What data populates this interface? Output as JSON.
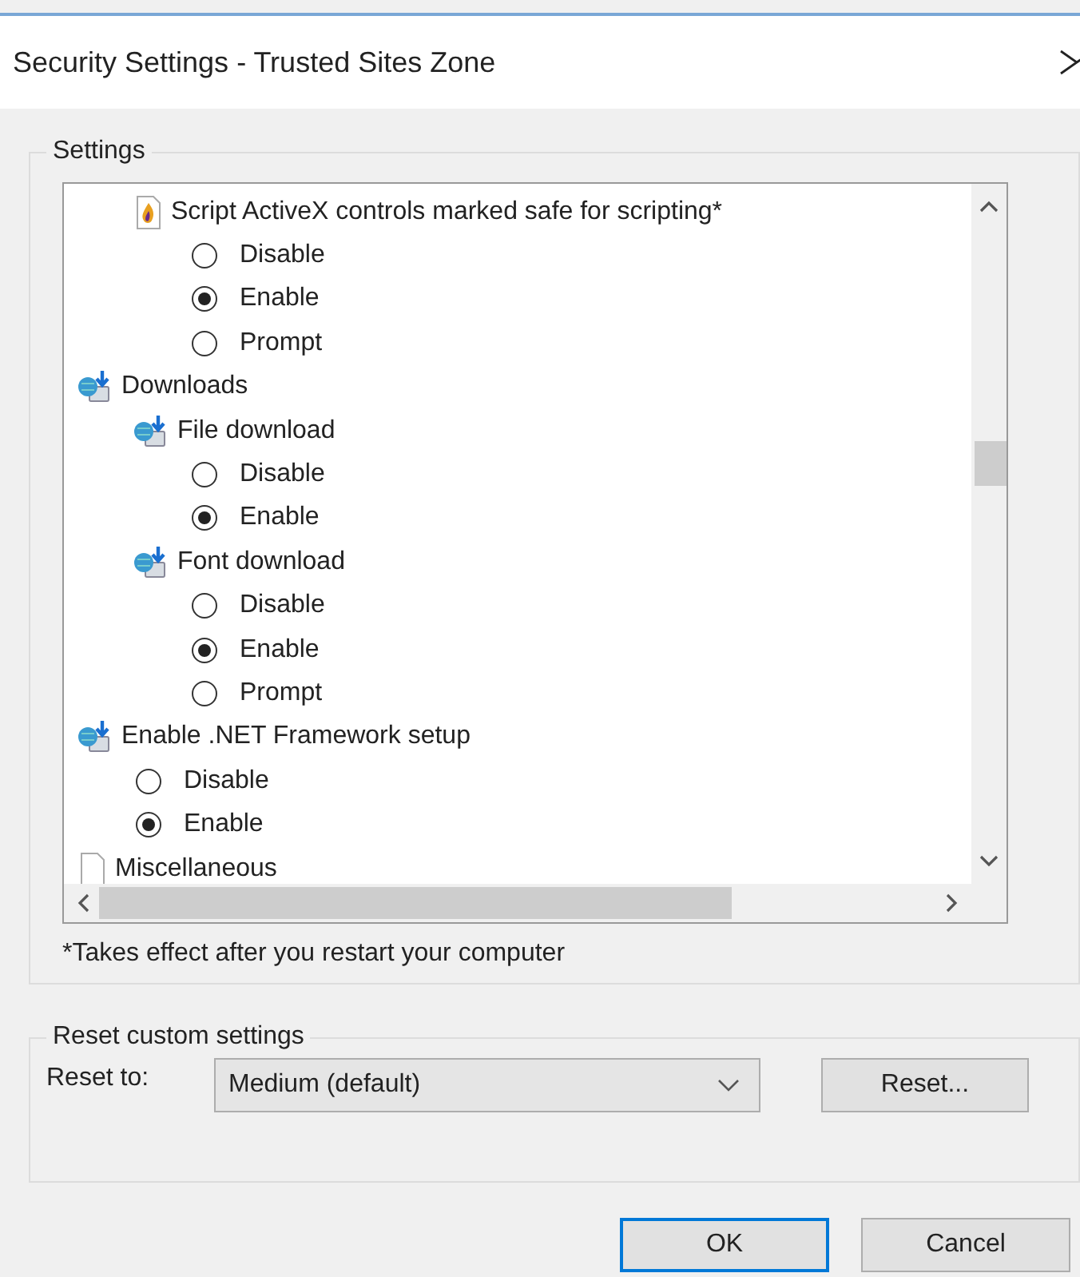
{
  "window": {
    "title": "Security Settings - Trusted Sites Zone"
  },
  "settings": {
    "legend": "Settings",
    "tree": [
      {
        "kind": "scrolled",
        "children": [
          {
            "kind": "activex",
            "label": "Script ActiveX controls marked safe for scripting*",
            "children": [
              {
                "kind": "option",
                "label": "Disable",
                "selected": false
              },
              {
                "kind": "option",
                "label": "Enable",
                "selected": true
              },
              {
                "kind": "option",
                "label": "Prompt",
                "selected": false
              }
            ]
          }
        ]
      },
      {
        "kind": "download",
        "label": "Downloads",
        "children": [
          {
            "kind": "download",
            "label": "File download",
            "children": [
              {
                "kind": "option",
                "label": "Disable",
                "selected": false
              },
              {
                "kind": "option",
                "label": "Enable",
                "selected": true
              }
            ]
          },
          {
            "kind": "download",
            "label": "Font download",
            "children": [
              {
                "kind": "option",
                "label": "Disable",
                "selected": false
              },
              {
                "kind": "option",
                "label": "Enable",
                "selected": true
              },
              {
                "kind": "option",
                "label": "Prompt",
                "selected": false
              }
            ]
          }
        ]
      },
      {
        "kind": "download",
        "label": "Enable .NET Framework setup",
        "children": [
          {
            "kind": "option",
            "label": "Disable",
            "selected": false
          },
          {
            "kind": "option",
            "label": "Enable",
            "selected": true
          }
        ]
      },
      {
        "kind": "misc",
        "label": "Miscellaneous"
      }
    ],
    "footnote": "*Takes effect after you restart your computer"
  },
  "reset": {
    "legend": "Reset custom settings",
    "label": "Reset to:",
    "value": "Medium (default)",
    "button": "Reset..."
  },
  "buttons": [
    {
      "label": "OK",
      "default": true
    },
    {
      "label": "Cancel",
      "default": false
    }
  ]
}
